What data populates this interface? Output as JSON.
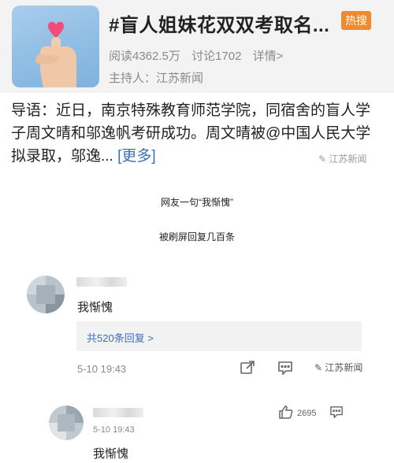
{
  "topic": {
    "title": "#盲人姐妹花双双考取名...",
    "hot_badge": "热搜",
    "reads": "阅读4362.5万",
    "discussion": "讨论1702",
    "details": "详情>",
    "host": "主持人：江苏新闻"
  },
  "intro": {
    "text": "导语：近日，南京特殊教育师范学院，同宿舍的盲人学子周文晴和邬逸帆考研成功。周文晴被@中国人民大学 拟录取，邬逸...",
    "more": "[更多]"
  },
  "watermark": "江苏新闻",
  "captions": {
    "line1": "网友一句“我惭愧”",
    "line2": "被刷屏回复几百条"
  },
  "comments": [
    {
      "text": "我惭愧",
      "replies": "共520条回复 >",
      "time": "5-10 19:43"
    },
    {
      "text": "我惭愧",
      "time": "5-10 19:43",
      "likes": "2695"
    }
  ],
  "colors": {
    "accent": "#3d6fb6",
    "hot": "#f08a2c"
  },
  "icons": [
    "thumb-heart-image",
    "share-icon",
    "comment-icon",
    "like-icon"
  ]
}
